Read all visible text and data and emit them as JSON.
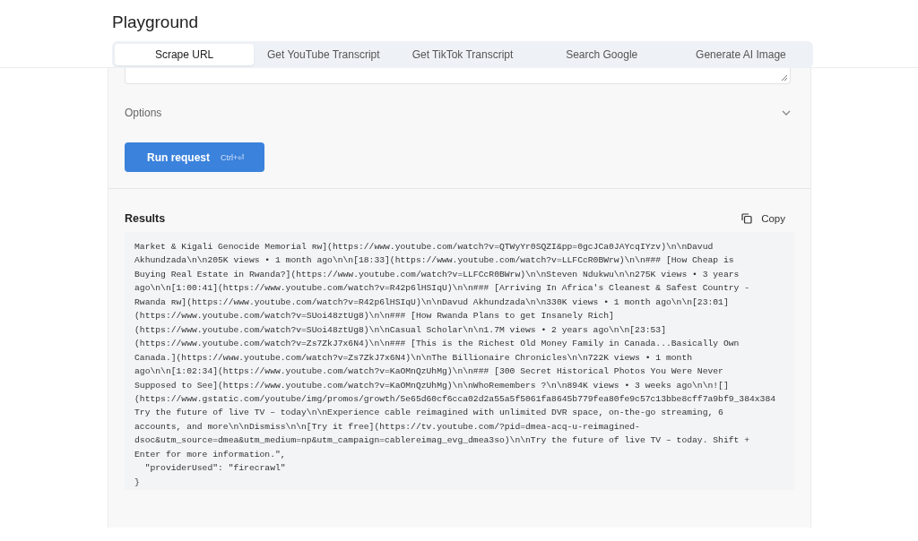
{
  "page": {
    "title": "Playground"
  },
  "tabs": [
    {
      "label": "Scrape URL",
      "selected": true
    },
    {
      "label": "Get YouTube Transcript",
      "selected": false
    },
    {
      "label": "Get TikTok Transcript",
      "selected": false
    },
    {
      "label": "Search Google",
      "selected": false
    },
    {
      "label": "Generate AI Image",
      "selected": false
    }
  ],
  "options": {
    "label": "Options",
    "expanded": false
  },
  "run_button": {
    "label": "Run request",
    "shortcut": "Ctrl+⏎"
  },
  "results": {
    "title": "Results",
    "copy_label": "Copy",
    "lines": [
      "Market & Kigali Genocide Memorial ʀᴡ](https://www.youtube.com/watch?v=QTWyYr0SQZI&pp=0gcJCa0JAYcqIYzv)\\n\\nDavud",
      "Akhundzada\\n\\n205K views • 1 month ago\\n\\n[18:33](https://www.youtube.com/watch?v=LLFCcR0BWrw)\\n\\n### [How Cheap is",
      "Buying Real Estate in Rwanda?](https://www.youtube.com/watch?v=LLFCcR0BWrw)\\n\\nSteven Ndukwu\\n\\n275K views • 3 years",
      "ago\\n\\n[1:00:41](https://www.youtube.com/watch?v=R42p6lHSIqU)\\n\\n### [Arriving In Africa's Cleanest & Safest Country -",
      "Rwanda ʀᴡ](https://www.youtube.com/watch?v=R42p6lHSIqU)\\n\\nDavud Akhundzada\\n\\n330K views • 1 month ago\\n\\n[23:01]",
      "(https://www.youtube.com/watch?v=SUoi48ztUg8)\\n\\n### [How Rwanda Plans to get Insanely Rich]",
      "(https://www.youtube.com/watch?v=SUoi48ztUg8)\\n\\nCasual Scholar\\n\\n1.7M views • 2 years ago\\n\\n[23:53]",
      "(https://www.youtube.com/watch?v=Zs7ZkJ7x6N4)\\n\\n### [This is the Richest Old Money Family in Canada...Basically Own",
      "Canada.](https://www.youtube.com/watch?v=Zs7ZkJ7x6N4)\\n\\nThe Billionaire Chronicles\\n\\n722K views • 1 month",
      "ago\\n\\n[1:02:34](https://www.youtube.com/watch?v=KaOMnQzUhMg)\\n\\n### [300 Secret Historical Photos You Were Never",
      "Supposed to See](https://www.youtube.com/watch?v=KaOMnQzUhMg)\\n\\nWhoRemembers ?\\n\\n894K views • 3 weeks ago\\n\\n![]",
      "(https://www.gstatic.com/youtube/img/promos/growth/5e65d60cf6cca02d2a55a5f5061fa8645b779fea80fe9c57c13bbe8cff7a9bf9_384x384",
      "Try the future of live TV – today\\n\\nExperience cable reimagined with unlimited DVR space, on-the-go streaming, 6",
      "accounts, and more\\n\\nDismiss\\n\\n[Try it free](https://tv.youtube.com/?pid=dmea-acq-u-reimagined-",
      "dsoc&utm_source=dmea&utm_medium=np&utm_campaign=cablereimag_evg_dmea3so)\\n\\nTry the future of live TV – today. Shift +",
      "Enter for more information.\",",
      "  \"providerUsed\": \"firecrawl\"",
      "}"
    ]
  }
}
